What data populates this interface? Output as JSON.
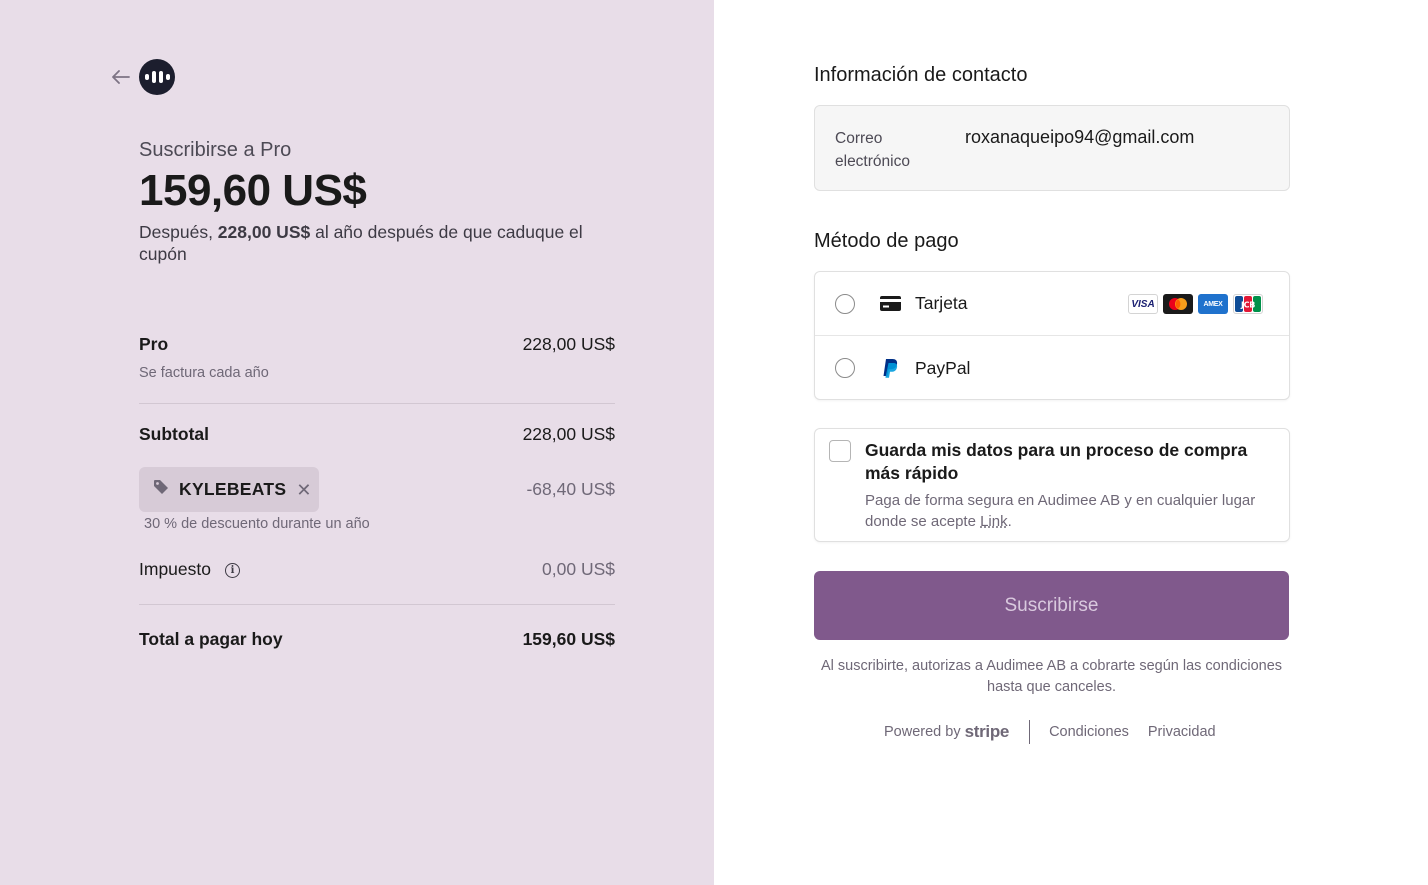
{
  "summary": {
    "product_title": "Suscribirse a Pro",
    "price": "159,60 US$",
    "after_prefix": "Después, ",
    "after_amount": "228,00 US$",
    "after_suffix": " al año después de que caduque el cupón",
    "items": [
      {
        "name": "Pro",
        "note": "Se factura cada año",
        "amount": "228,00 US$"
      }
    ],
    "subtotal_label": "Subtotal",
    "subtotal_value": "228,00 US$",
    "coupon": {
      "code": "KYLEBEATS",
      "discount": "-68,40 US$",
      "note": "30 % de descuento durante un año"
    },
    "tax_label": "Impuesto",
    "tax_value": "0,00 US$",
    "total_label": "Total a pagar hoy",
    "total_value": "159,60 US$"
  },
  "contact": {
    "title": "Información de contacto",
    "email_label": "Correo electrónico",
    "email_value": "roxanaqueipo94@gmail.com"
  },
  "payment": {
    "title": "Método de pago",
    "methods": [
      {
        "label": "Tarjeta",
        "icon": "card-icon"
      },
      {
        "label": "PayPal",
        "icon": "paypal-icon"
      }
    ],
    "brands": {
      "visa": "VISA",
      "amex": "AMEX",
      "jcb": "JCB"
    }
  },
  "save": {
    "title": "Guarda mis datos para un proceso de compra más rápido",
    "desc_prefix": "Paga de forma segura en Audimee AB y en cualquier lugar donde se acepte ",
    "link_word": "Link",
    "desc_suffix": "."
  },
  "subscribe_label": "Suscribirse",
  "terms": "Al suscribirte, autorizas a Audimee AB a cobrarte según las condiciones hasta que canceles.",
  "footer": {
    "powered_by": "Powered by",
    "brand": "stripe",
    "terms_link": "Condiciones",
    "privacy_link": "Privacidad"
  },
  "colors": {
    "left_bg": "#e8dde8",
    "button_bg": "#80598c",
    "logo_bg": "#1c1e2e"
  }
}
